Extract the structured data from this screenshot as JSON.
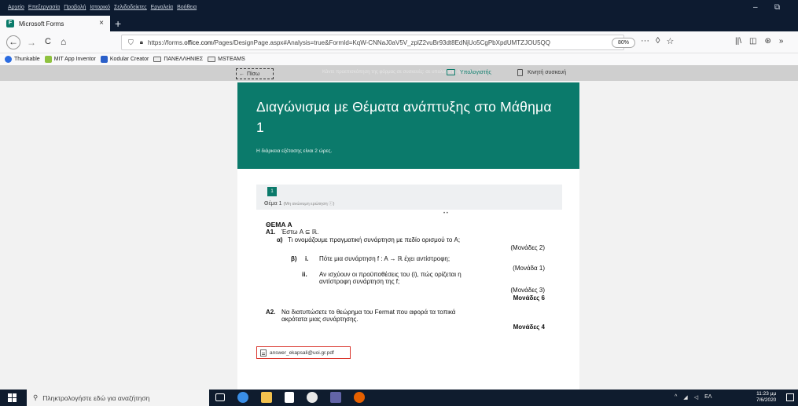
{
  "menubar": {
    "items": [
      "Αρχείο",
      "Επεξεργασία",
      "Προβολή",
      "Ιστορικό",
      "Σελιδοδείκτες",
      "Εργαλεία",
      "Βοήθεια"
    ],
    "minimize_glyph": "–",
    "restore_glyph": "⧉"
  },
  "tab": {
    "title": "Microsoft Forms",
    "close": "×",
    "new_tab": "+"
  },
  "navbar": {
    "back": "←",
    "forward": "→",
    "reload": "C",
    "home": "⌂",
    "url_prefix": "https://forms.",
    "url_host": "office.com",
    "url_rest": "/Pages/DesignPage.aspx#Analysis=true&FormId=KqW-CNNaJ0aV5V_zplZ2vuBr93dt8EdNjUo5CgPbXpdUMTZJOU5QQ",
    "zoom": "80%",
    "more": "···",
    "pocket": "◊",
    "star": "☆",
    "library": "||\\",
    "sidebar": "◫",
    "account": "⊛",
    "overflow": "»"
  },
  "bookmarks": [
    {
      "label": "Thunkable",
      "icon": "thunkable-icon",
      "color": "#2a6be0"
    },
    {
      "label": "MIT App Inventor",
      "icon": "mit-app-inventor-icon",
      "color": "#8fc23f"
    },
    {
      "label": "Kodular Creator",
      "icon": "kodular-icon",
      "color": "#2a5fc9"
    },
    {
      "label": "ΠΑΝΕΛΛΗΝΙΕΣ",
      "icon": "folder-icon",
      "color": "#eeeeee"
    },
    {
      "label": "MSTEAMS",
      "icon": "folder-icon",
      "color": "#eeeeee"
    }
  ],
  "preview": {
    "back": "Πίσω",
    "hint": "Κάντε προεπισκόπηση της φόρμας σε συσκευές: σε υπολογιστή ή σε κινητό",
    "computer": "Υπολογιστής",
    "mobile": "Κινητή συσκευή"
  },
  "form": {
    "title": "Διαγώνισμα με Θέματα ανάπτυξης στο Μάθημα 1",
    "description": "Η διάρκεια εξέτασης είναι 2 ώρες.",
    "question_number": "1",
    "question_label": "Θέμα 1",
    "question_sub": "(Μη ανώνυμη ερώτηση ⓘ)",
    "attachment": "answer_ekapsali@uoi.gr.pdf"
  },
  "exam": {
    "dots": "• •",
    "heading": "ΘΕΜΑ Α",
    "a1_label": "Α1.",
    "a1_text": "Έστω A ⊆ ℝ.",
    "a_label": "α)",
    "a_text": "Τι ονομάζουμε πραγματική συνάρτηση με πεδίο ορισμού το A;",
    "marks_2": "(Μονάδες 2)",
    "b_label": "β)",
    "bi_label": "i.",
    "bi_text": "Πότε μια συνάρτηση f : A → ℝ έχει αντίστροφη;",
    "marks_1": "(Μονάδα 1)",
    "bii_label": "ii.",
    "bii_text_1": "Αν ισχύουν οι προϋποθέσεις του (i), πώς ορίζεται η",
    "bii_text_2": "αντίστροφη συνάρτηση της f;",
    "marks_3": "(Μονάδες 3)",
    "marks_6": "Μονάδες 6",
    "a2_label": "Α2.",
    "a2_text_1": "Να διατυπώσετε το θεώρημα του Fermat που αφορά τα τοπικά",
    "a2_text_2": "ακρότατα μιας συνάρτησης.",
    "marks_4": "Μονάδες 4"
  },
  "taskbar": {
    "search_placeholder": "Πληκτρολογήστε εδώ για αναζήτηση",
    "tray_lang": "ΕΛ",
    "clock_time": "11:23 μμ",
    "clock_date": "7/6/2020",
    "apps": [
      {
        "name": "task-view-icon",
        "color": "#ffffff"
      },
      {
        "name": "edge-icon",
        "color": "#3a8ee6"
      },
      {
        "name": "file-explorer-icon",
        "color": "#f2c14e"
      },
      {
        "name": "store-icon",
        "color": "#ffffff"
      },
      {
        "name": "chrome-icon",
        "color": "#e8e8e8"
      },
      {
        "name": "teams-icon",
        "color": "#6264a7"
      },
      {
        "name": "firefox-icon",
        "color": "#e66000"
      }
    ]
  }
}
